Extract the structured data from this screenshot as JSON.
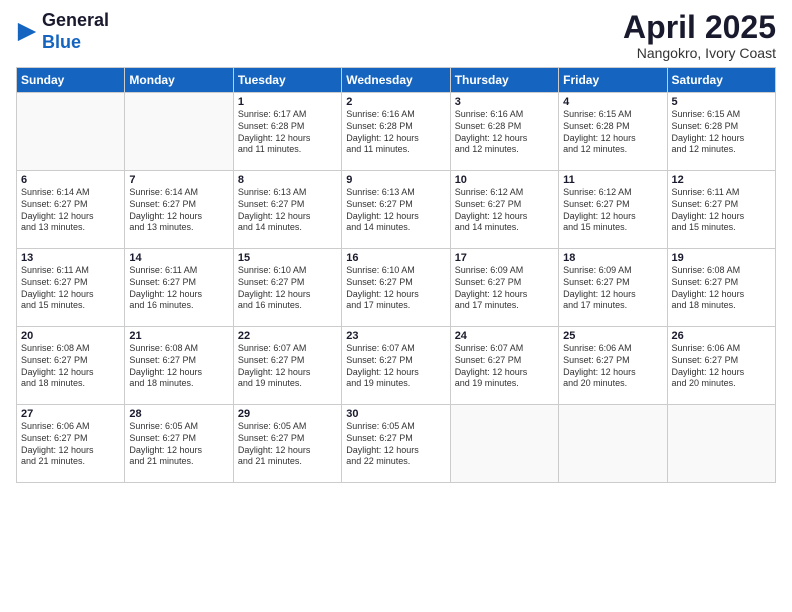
{
  "logo": {
    "general": "General",
    "blue": "Blue"
  },
  "title": "April 2025",
  "location": "Nangokro, Ivory Coast",
  "days_of_week": [
    "Sunday",
    "Monday",
    "Tuesday",
    "Wednesday",
    "Thursday",
    "Friday",
    "Saturday"
  ],
  "weeks": [
    [
      {
        "day": "",
        "info": ""
      },
      {
        "day": "",
        "info": ""
      },
      {
        "day": "1",
        "info": "Sunrise: 6:17 AM\nSunset: 6:28 PM\nDaylight: 12 hours\nand 11 minutes."
      },
      {
        "day": "2",
        "info": "Sunrise: 6:16 AM\nSunset: 6:28 PM\nDaylight: 12 hours\nand 11 minutes."
      },
      {
        "day": "3",
        "info": "Sunrise: 6:16 AM\nSunset: 6:28 PM\nDaylight: 12 hours\nand 12 minutes."
      },
      {
        "day": "4",
        "info": "Sunrise: 6:15 AM\nSunset: 6:28 PM\nDaylight: 12 hours\nand 12 minutes."
      },
      {
        "day": "5",
        "info": "Sunrise: 6:15 AM\nSunset: 6:28 PM\nDaylight: 12 hours\nand 12 minutes."
      }
    ],
    [
      {
        "day": "6",
        "info": "Sunrise: 6:14 AM\nSunset: 6:27 PM\nDaylight: 12 hours\nand 13 minutes."
      },
      {
        "day": "7",
        "info": "Sunrise: 6:14 AM\nSunset: 6:27 PM\nDaylight: 12 hours\nand 13 minutes."
      },
      {
        "day": "8",
        "info": "Sunrise: 6:13 AM\nSunset: 6:27 PM\nDaylight: 12 hours\nand 14 minutes."
      },
      {
        "day": "9",
        "info": "Sunrise: 6:13 AM\nSunset: 6:27 PM\nDaylight: 12 hours\nand 14 minutes."
      },
      {
        "day": "10",
        "info": "Sunrise: 6:12 AM\nSunset: 6:27 PM\nDaylight: 12 hours\nand 14 minutes."
      },
      {
        "day": "11",
        "info": "Sunrise: 6:12 AM\nSunset: 6:27 PM\nDaylight: 12 hours\nand 15 minutes."
      },
      {
        "day": "12",
        "info": "Sunrise: 6:11 AM\nSunset: 6:27 PM\nDaylight: 12 hours\nand 15 minutes."
      }
    ],
    [
      {
        "day": "13",
        "info": "Sunrise: 6:11 AM\nSunset: 6:27 PM\nDaylight: 12 hours\nand 15 minutes."
      },
      {
        "day": "14",
        "info": "Sunrise: 6:11 AM\nSunset: 6:27 PM\nDaylight: 12 hours\nand 16 minutes."
      },
      {
        "day": "15",
        "info": "Sunrise: 6:10 AM\nSunset: 6:27 PM\nDaylight: 12 hours\nand 16 minutes."
      },
      {
        "day": "16",
        "info": "Sunrise: 6:10 AM\nSunset: 6:27 PM\nDaylight: 12 hours\nand 17 minutes."
      },
      {
        "day": "17",
        "info": "Sunrise: 6:09 AM\nSunset: 6:27 PM\nDaylight: 12 hours\nand 17 minutes."
      },
      {
        "day": "18",
        "info": "Sunrise: 6:09 AM\nSunset: 6:27 PM\nDaylight: 12 hours\nand 17 minutes."
      },
      {
        "day": "19",
        "info": "Sunrise: 6:08 AM\nSunset: 6:27 PM\nDaylight: 12 hours\nand 18 minutes."
      }
    ],
    [
      {
        "day": "20",
        "info": "Sunrise: 6:08 AM\nSunset: 6:27 PM\nDaylight: 12 hours\nand 18 minutes."
      },
      {
        "day": "21",
        "info": "Sunrise: 6:08 AM\nSunset: 6:27 PM\nDaylight: 12 hours\nand 18 minutes."
      },
      {
        "day": "22",
        "info": "Sunrise: 6:07 AM\nSunset: 6:27 PM\nDaylight: 12 hours\nand 19 minutes."
      },
      {
        "day": "23",
        "info": "Sunrise: 6:07 AM\nSunset: 6:27 PM\nDaylight: 12 hours\nand 19 minutes."
      },
      {
        "day": "24",
        "info": "Sunrise: 6:07 AM\nSunset: 6:27 PM\nDaylight: 12 hours\nand 19 minutes."
      },
      {
        "day": "25",
        "info": "Sunrise: 6:06 AM\nSunset: 6:27 PM\nDaylight: 12 hours\nand 20 minutes."
      },
      {
        "day": "26",
        "info": "Sunrise: 6:06 AM\nSunset: 6:27 PM\nDaylight: 12 hours\nand 20 minutes."
      }
    ],
    [
      {
        "day": "27",
        "info": "Sunrise: 6:06 AM\nSunset: 6:27 PM\nDaylight: 12 hours\nand 21 minutes."
      },
      {
        "day": "28",
        "info": "Sunrise: 6:05 AM\nSunset: 6:27 PM\nDaylight: 12 hours\nand 21 minutes."
      },
      {
        "day": "29",
        "info": "Sunrise: 6:05 AM\nSunset: 6:27 PM\nDaylight: 12 hours\nand 21 minutes."
      },
      {
        "day": "30",
        "info": "Sunrise: 6:05 AM\nSunset: 6:27 PM\nDaylight: 12 hours\nand 22 minutes."
      },
      {
        "day": "",
        "info": ""
      },
      {
        "day": "",
        "info": ""
      },
      {
        "day": "",
        "info": ""
      }
    ]
  ]
}
